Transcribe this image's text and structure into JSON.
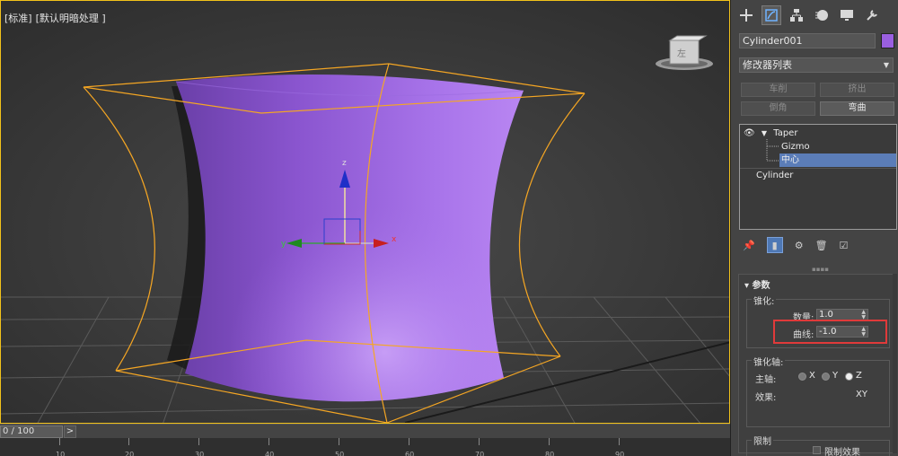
{
  "viewport": {
    "label_parts": [
      "[标准]",
      "[默认明暗处理 ]"
    ],
    "viewcube_label": "左",
    "object_color": "#9a5fe0",
    "gizmo_color": "#f5a623",
    "axis_x": "x",
    "axis_y": "y",
    "axis_z": "z"
  },
  "timeline": {
    "frame_display": "0 / 100",
    "next_button": ">",
    "ticks": [
      "10",
      "20",
      "30",
      "40",
      "50",
      "60",
      "70",
      "80",
      "90"
    ]
  },
  "command_panel": {
    "tabs": [
      "create-icon",
      "modify-icon",
      "hierarchy-icon",
      "motion-icon",
      "display-icon",
      "utilities-icon"
    ],
    "object_name": "Cylinder001",
    "modifier_list": "修改器列表",
    "modifier_buttons": [
      "车削",
      "挤出",
      "倒角",
      "弯曲"
    ],
    "stack": {
      "taper": "Taper",
      "gizmo": "Gizmo",
      "center": "中心",
      "cylinder": "Cylinder"
    },
    "params": {
      "title": "参数",
      "taper_group": "锥化:",
      "amount_label": "数量:",
      "amount_value": "1.0",
      "curve_label": "曲线:",
      "curve_value": "-1.0",
      "axis_group": "锥化轴:",
      "primary_label": "主轴:",
      "axes": [
        "X",
        "Y",
        "Z"
      ],
      "effect_label": "效果:",
      "effect_value": "XY",
      "limit_group": "限制",
      "limit_effect": "限制效果"
    }
  }
}
